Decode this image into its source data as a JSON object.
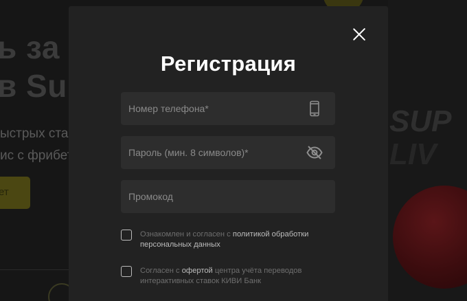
{
  "background": {
    "headline_line1": "ь за",
    "headline_line2": "в Su",
    "sub_line1": "ыстрых ста",
    "sub_line2": "ис с фрибет",
    "button_label": "ет",
    "right_text1": "SUP",
    "right_text2": "LIV"
  },
  "modal": {
    "title": "Регистрация",
    "close_icon": "close-icon",
    "phone": {
      "placeholder": "Номер телефона*",
      "value": "",
      "icon": "phone-icon"
    },
    "password": {
      "placeholder": "Пароль (мин. 8 символов)*",
      "value": "",
      "icon": "eye-off-icon"
    },
    "promo": {
      "placeholder": "Промокод",
      "value": ""
    },
    "consent1": {
      "checked": false,
      "text_before": "Ознакомлен и согласен с ",
      "link": "политикой обработки персональных данных",
      "text_after": ""
    },
    "consent2": {
      "checked": false,
      "text_before": "Согласен с ",
      "link": "офертой",
      "text_after": " центра учёта переводов интерактивных ставок КИВИ Банк"
    }
  },
  "colors": {
    "modal_bg": "#222222",
    "field_bg": "#2d2d2d",
    "link": "#bdbdbd",
    "muted_text": "#6f6f6f"
  }
}
